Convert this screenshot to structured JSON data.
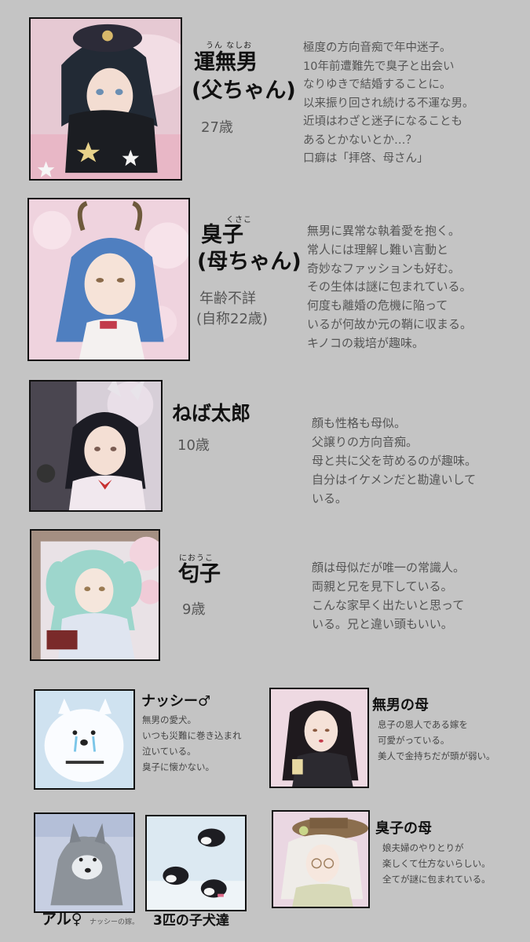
{
  "characters": [
    {
      "ruby": "うん なしお",
      "name_line1": "運無男",
      "name_line2": "(父ちゃん)",
      "age": "27歳",
      "desc": [
        "極度の方向音痴で年中迷子。",
        "10年前遭難先で臭子と出会い",
        "なりゆきで結婚することに。",
        "以来振り回され続ける不運な男。",
        "近頃はわざと迷子になることも",
        "あるとかないとか…？",
        "口癖は「拝啓、母さん」"
      ]
    },
    {
      "ruby": "くさこ",
      "name_line1": "臭子",
      "name_line2": "(母ちゃん)",
      "age_line1": "年齢不詳",
      "age_line2": "(自称22歳)",
      "desc": [
        "無男に異常な執着愛を抱く。",
        "常人には理解し難い言動と",
        "奇妙なファッションも好む。",
        "その生体は謎に包まれている。",
        "何度も離婚の危機に陥って",
        "いるが何故か元の鞘に収まる。",
        "キノコの栽培が趣味。"
      ]
    },
    {
      "name_line1": "ねば太郎",
      "age": "10歳",
      "desc": [
        "顔も性格も母似。",
        "父譲りの方向音痴。",
        "母と共に父を苛めるのが趣味。",
        "自分はイケメンだと勘違いして",
        "いる。"
      ]
    },
    {
      "ruby": "におうこ",
      "name_line1": "匂子",
      "age": "9歳",
      "desc": [
        "顔は母似だが唯一の常識人。",
        "両親と兄を見下している。",
        "こんな家早く出たいと思って",
        "いる。兄と違い頭もいい。"
      ]
    }
  ],
  "extras": {
    "nasshi": {
      "name": "ナッシー♂",
      "desc": [
        "無男の愛犬。",
        "いつも災難に巻き込まれ",
        "泣いている。",
        "臭子に懐かない。"
      ]
    },
    "nashio_mother": {
      "name": "無男の母",
      "desc": [
        "息子の恩人である嫁を",
        "可愛がっている。",
        "美人で金持ちだが頭が弱い。"
      ]
    },
    "aru": {
      "name": "アル♀",
      "note": "ナッシーの嫁。"
    },
    "puppies": {
      "name": "3匹の子犬達"
    },
    "kusako_mother": {
      "name": "臭子の母",
      "desc": [
        "娘夫婦のやりとりが",
        "楽しくて仕方ないらしい。",
        "全てが謎に包まれている。"
      ]
    }
  }
}
